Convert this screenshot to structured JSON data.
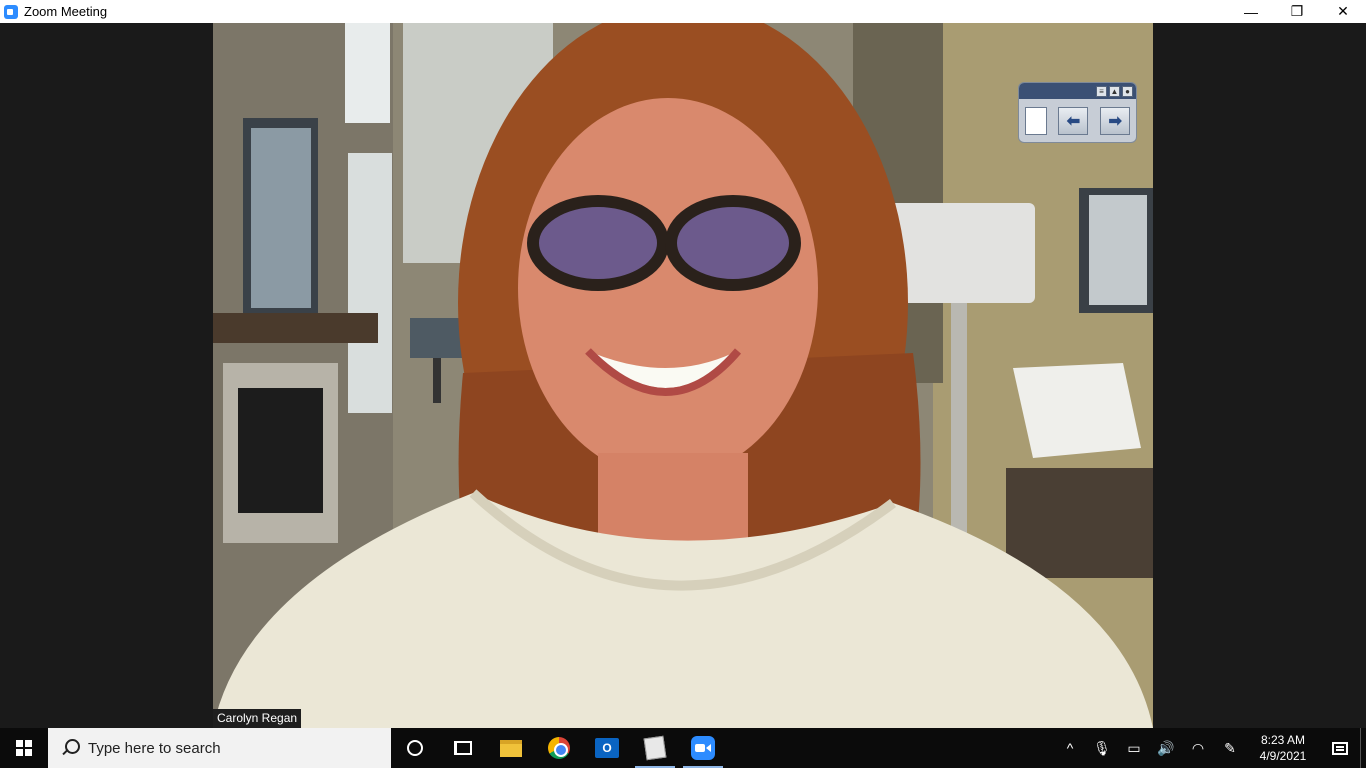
{
  "window": {
    "title": "Zoom Meeting",
    "controls": {
      "minimize": "—",
      "restore": "❐",
      "close": "✕"
    }
  },
  "meeting": {
    "participant_name": "Carolyn Regan",
    "video_description_icon": "participant-video"
  },
  "taskbar": {
    "search_placeholder": "Type here to search",
    "pinned_apps": [
      "cortana",
      "task-view",
      "file-explorer",
      "chrome",
      "outlook",
      "notepad",
      "zoom"
    ],
    "outlook_label": "O",
    "tray": {
      "chevron": "^",
      "mic": "🎙",
      "battery": "▭",
      "volume": "🔊",
      "wifi": "◠",
      "pen": "✎"
    },
    "time": "8:23 AM",
    "date": "4/9/2021"
  }
}
